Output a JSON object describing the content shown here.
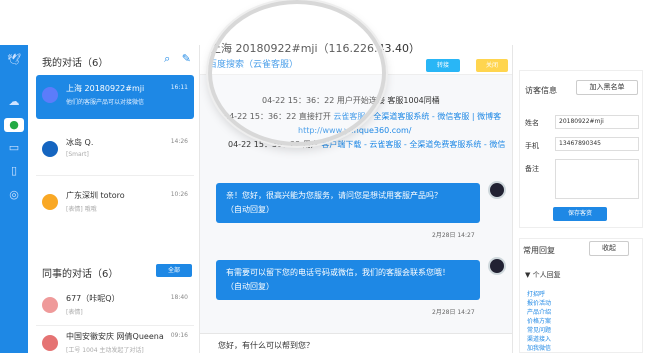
{
  "rail": {
    "icons": [
      "logo-bird-icon",
      "visitor-icon",
      "wechat-icon",
      "message-icon",
      "mobile-icon",
      "compass-icon"
    ]
  },
  "conversations": {
    "header": "我的对话（6）",
    "search_icon": "search-icon",
    "edit_icon": "edit-icon",
    "items": [
      {
        "name": "上海 20180922#mji",
        "sub": "他们的客服产品可以对接微信",
        "time": "16:11",
        "avatar_color": "#5c7cfa"
      },
      {
        "name": "冰岛 Q.",
        "sub": "[Smart]",
        "time": "14:26",
        "avatar_color": "#1565c0"
      },
      {
        "name": "广东深圳 totoro",
        "sub": "[表情] 哦哦",
        "time": "10:26",
        "avatar_color": "#f9a825"
      }
    ]
  },
  "colleagues": {
    "header": "同事的对话（6）",
    "all_label": "全部",
    "items": [
      {
        "name": "677（咔呢Q）",
        "sub": "[表情]",
        "time": "18:40",
        "avatar_color": "#ef9a9a"
      },
      {
        "name": "中国安徽安庆 网倩Queena",
        "sub": "[工号 1004 主动发起了对话]",
        "time": "09:16",
        "avatar_color": "#e57373"
      }
    ]
  },
  "chat": {
    "title": "上海 20180922#mji（116.226.43.40）",
    "subtitle": "百度搜索（云雀客服）",
    "transfer_label": "转接",
    "close_label": "关闭",
    "system_lines": [
      {
        "text": "04-22 15：36：22 用户开始连接 客服1004同桶",
        "link": ""
      },
      {
        "text": "04-22 15：36：22 直接打开",
        "link": "云雀客服 - 全渠道客服系统 - 微信客服 | 微博客"
      },
      {
        "text": "",
        "link": "http://www.yunque360.com/"
      },
      {
        "text": "04-22 15：36：22 用户",
        "link": "客户端下载 - 云雀客服 - 全渠道免费客服系统 - 微信"
      }
    ],
    "messages": [
      {
        "text": "亲！您好，很高兴能为您服务，请问您是想试用客服产品吗？",
        "auto": "（自动回复）",
        "time": "2月28日 14:27"
      },
      {
        "text": "有需要可以留下您的电话号码或微信，我们的客服会联系您哦！",
        "auto": "（自动回复）",
        "time": "2月28日 14:27"
      }
    ],
    "input_text": "您好，有什么可以帮到您？"
  },
  "info": {
    "header": "访客信息",
    "blacklist_label": "加入黑名单",
    "name_label": "姓名",
    "name_value": "20180922#mji",
    "phone_label": "手机",
    "phone_value": "13467890345",
    "note_label": "备注",
    "save_label": "保存客资"
  },
  "replies": {
    "header": "常用回复",
    "collapse_label": "收起",
    "group": "▼ 个人回复",
    "items": [
      "打招呼",
      "报价活动",
      "产品介绍",
      "价格方案",
      "常见问题",
      "渠道接入",
      "加我微信"
    ]
  }
}
